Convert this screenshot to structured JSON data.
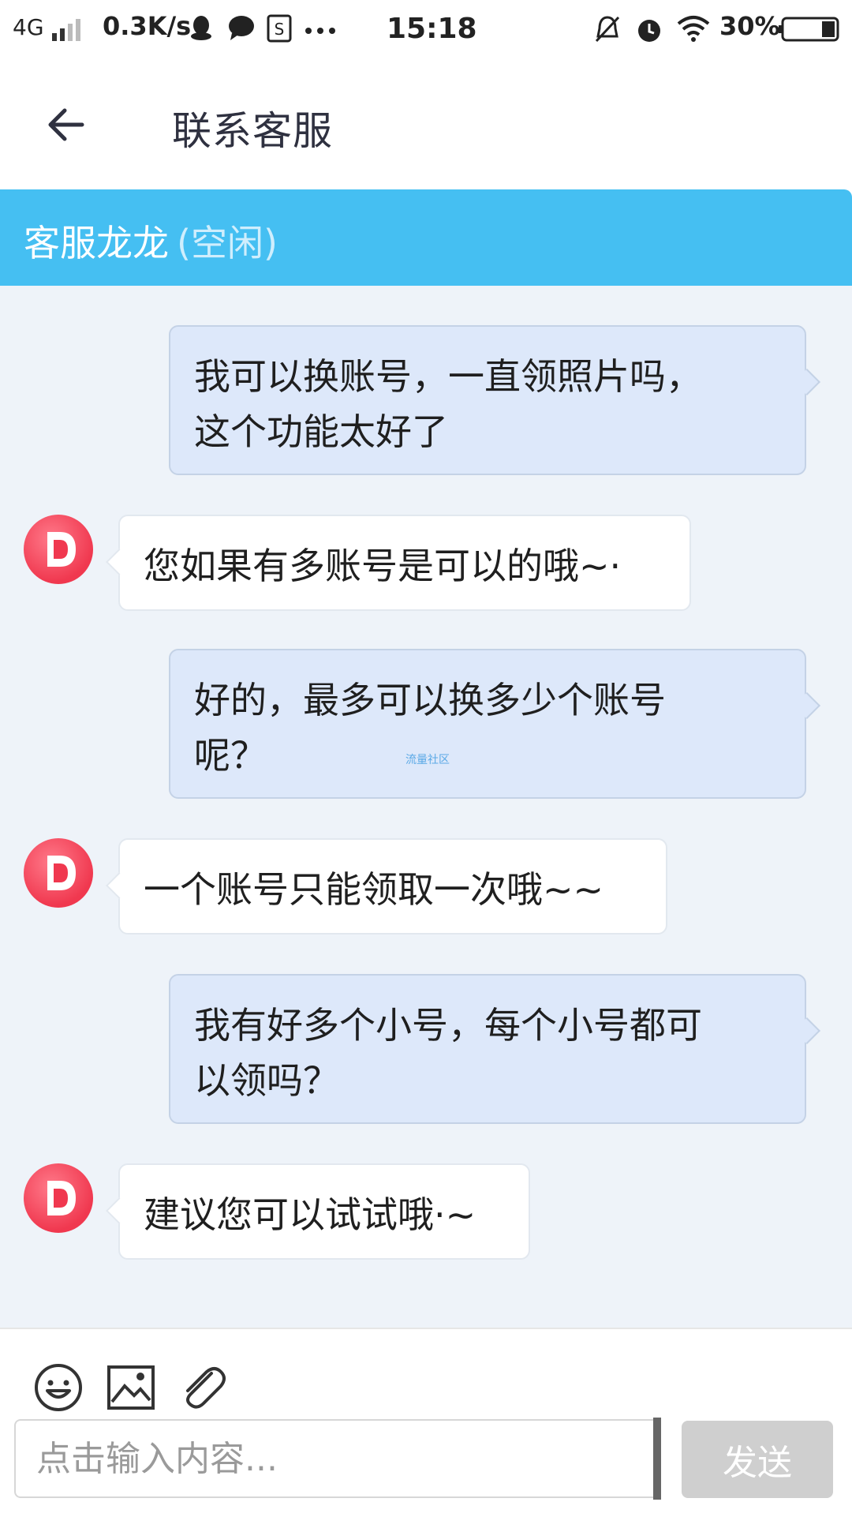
{
  "status_bar": {
    "network": "4G",
    "speed": "0.3K/s",
    "time": "15:18",
    "battery": "30%"
  },
  "header": {
    "title": "联系客服",
    "back_icon": "arrow-left-icon"
  },
  "agent": {
    "name": "客服龙龙",
    "status": "(空闲)"
  },
  "messages": [
    {
      "from": "me",
      "lines": [
        "我可以换账号，一直领照片吗，",
        "这个功能太好了"
      ]
    },
    {
      "from": "agent",
      "lines": [
        "您如果有多账号是可以的哦~·"
      ]
    },
    {
      "from": "me",
      "lines": [
        "好的，最多可以换多少个账号",
        "呢？"
      ]
    },
    {
      "from": "agent",
      "lines": [
        "一个账号只能领取一次哦~~"
      ]
    },
    {
      "from": "me",
      "lines": [
        "我有好多个小号，每个小号都可",
        "以领吗？"
      ]
    },
    {
      "from": "agent",
      "lines": [
        "建议您可以试试哦·~"
      ]
    }
  ],
  "watermark": "流量社区",
  "composer": {
    "placeholder": "点击输入内容...",
    "send_label": "发送",
    "tools": [
      "emoji-icon",
      "image-icon",
      "attachment-icon"
    ]
  },
  "colors": {
    "agent_bar": "#45bff2",
    "my_bubble": "#dde8fa",
    "agent_bubble": "#ffffff",
    "chat_bg": "#eef3f9",
    "avatar": "#f0384f"
  }
}
